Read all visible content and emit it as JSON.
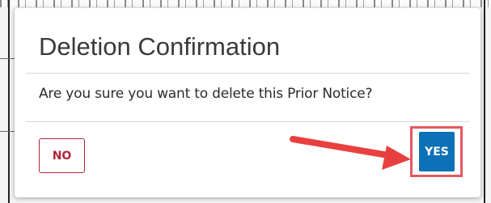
{
  "dialog": {
    "title": "Deletion Confirmation",
    "message": "Are you sure you want to delete this Prior Notice?",
    "no_label": "NO",
    "yes_label": "YES"
  },
  "colors": {
    "danger": "#b4233a",
    "primary": "#0c71b6",
    "highlight": "#e35a5f"
  },
  "annotation": {
    "arrow_icon": "red-arrow-icon",
    "highlight": "callout-box"
  }
}
